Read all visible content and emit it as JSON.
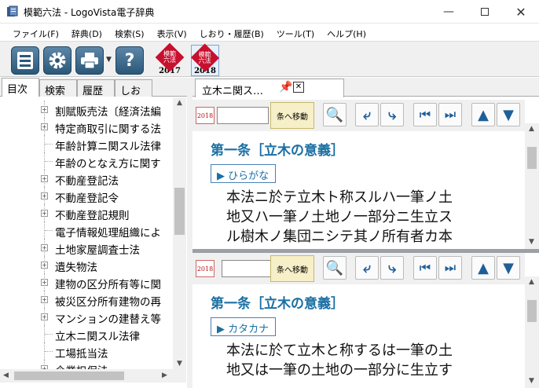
{
  "window": {
    "title": "模範六法 - LogoVista電子辞典"
  },
  "menu": [
    "ファイル(F)",
    "辞典(D)",
    "検索(S)",
    "表示(V)",
    "しおり・履歴(B)",
    "ツール(T)",
    "ヘルプ(H)"
  ],
  "toolbar": {
    "books": [
      {
        "name": "模範六法",
        "year": "2017"
      },
      {
        "name": "模範六法",
        "year": "2018"
      }
    ]
  },
  "left_tabs": [
    "目次",
    "検索",
    "履歴",
    "しおり"
  ],
  "tree": [
    {
      "label": "割賦販売法〔経済法編",
      "expandable": true
    },
    {
      "label": "特定商取引に関する法",
      "expandable": true
    },
    {
      "label": "年齢計算ニ関スル法律",
      "expandable": false
    },
    {
      "label": "年齢のとなえ方に関す",
      "expandable": false
    },
    {
      "label": "不動産登記法",
      "expandable": true
    },
    {
      "label": "不動産登記令",
      "expandable": true
    },
    {
      "label": "不動産登記規則",
      "expandable": true
    },
    {
      "label": "電子情報処理組織によ",
      "expandable": false
    },
    {
      "label": "土地家屋調査士法",
      "expandable": true
    },
    {
      "label": "遺失物法",
      "expandable": true
    },
    {
      "label": "建物の区分所有等に関",
      "expandable": true
    },
    {
      "label": "被災区分所有建物の再",
      "expandable": true
    },
    {
      "label": "マンションの建替え等",
      "expandable": true
    },
    {
      "label": "立木ニ関スル法律",
      "expandable": false
    },
    {
      "label": "工場抵当法",
      "expandable": false
    },
    {
      "label": "企業担保法",
      "expandable": true
    }
  ],
  "doc_tab": {
    "label": "立木ニ関ス…"
  },
  "panes": [
    {
      "badge": "2018",
      "move_label": "条へ移動",
      "article_title": "第一条［立木の意義］",
      "kana_label": "▶ ひらがな",
      "lines": [
        "本法ニ於テ立木ト称スルハ一筆ノ土",
        "地又ハ一筆ノ土地ノ一部分ニ生立ス",
        "ル樹木ノ集団ニシテ其ノ所有者カ本"
      ]
    },
    {
      "badge": "2018",
      "move_label": "条へ移動",
      "article_title": "第一条［立木の意義］",
      "kana_label": "▶ カタカナ",
      "lines": [
        "本法に於て立木と称するは一筆の土",
        "地又は一筆の土地の一部分に生立す"
      ]
    }
  ]
}
